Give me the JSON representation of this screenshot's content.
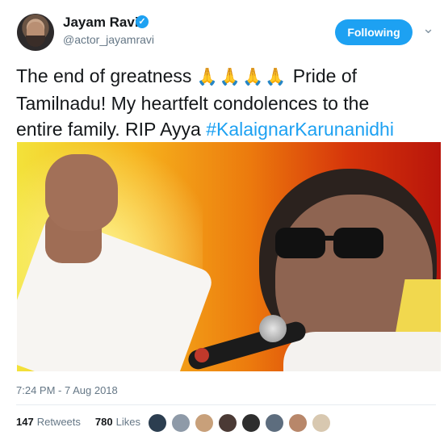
{
  "tweet": {
    "author_name": "Jayam Ravi",
    "handle": "@actor_jayamravi",
    "verified": true,
    "follow_label": "Following",
    "text_line1": "The end of greatness",
    "emoji": "🙏🙏🙏🙏",
    "text_line1_tail": "Pride of",
    "text_line2": "Tamilnadu! My heartfelt condolences to the",
    "text_line3": "entire family. RIP Ayya",
    "hashtag": "#KalaignarKarunanidhi",
    "timestamp": "7:24 PM - 7 Aug 2018",
    "retweets_count": "147",
    "retweets_label": "Retweets",
    "likes_count": "780",
    "likes_label": "Likes"
  },
  "colors": {
    "accent": "#1da1f2",
    "text": "#14171a",
    "muted": "#657786"
  },
  "likers": [
    {
      "name": "liker-avatar-1",
      "color": "#2c3e50"
    },
    {
      "name": "liker-avatar-2",
      "color": "#8e9aa8"
    },
    {
      "name": "liker-avatar-3",
      "color": "#c8a07a"
    },
    {
      "name": "liker-avatar-4",
      "color": "#4b3a35"
    },
    {
      "name": "liker-avatar-5",
      "color": "#2e2e2e"
    },
    {
      "name": "liker-avatar-6",
      "color": "#5d6d7e"
    },
    {
      "name": "liker-avatar-7",
      "color": "#b8876a"
    },
    {
      "name": "liker-avatar-8",
      "color": "#d8c8b0"
    }
  ]
}
